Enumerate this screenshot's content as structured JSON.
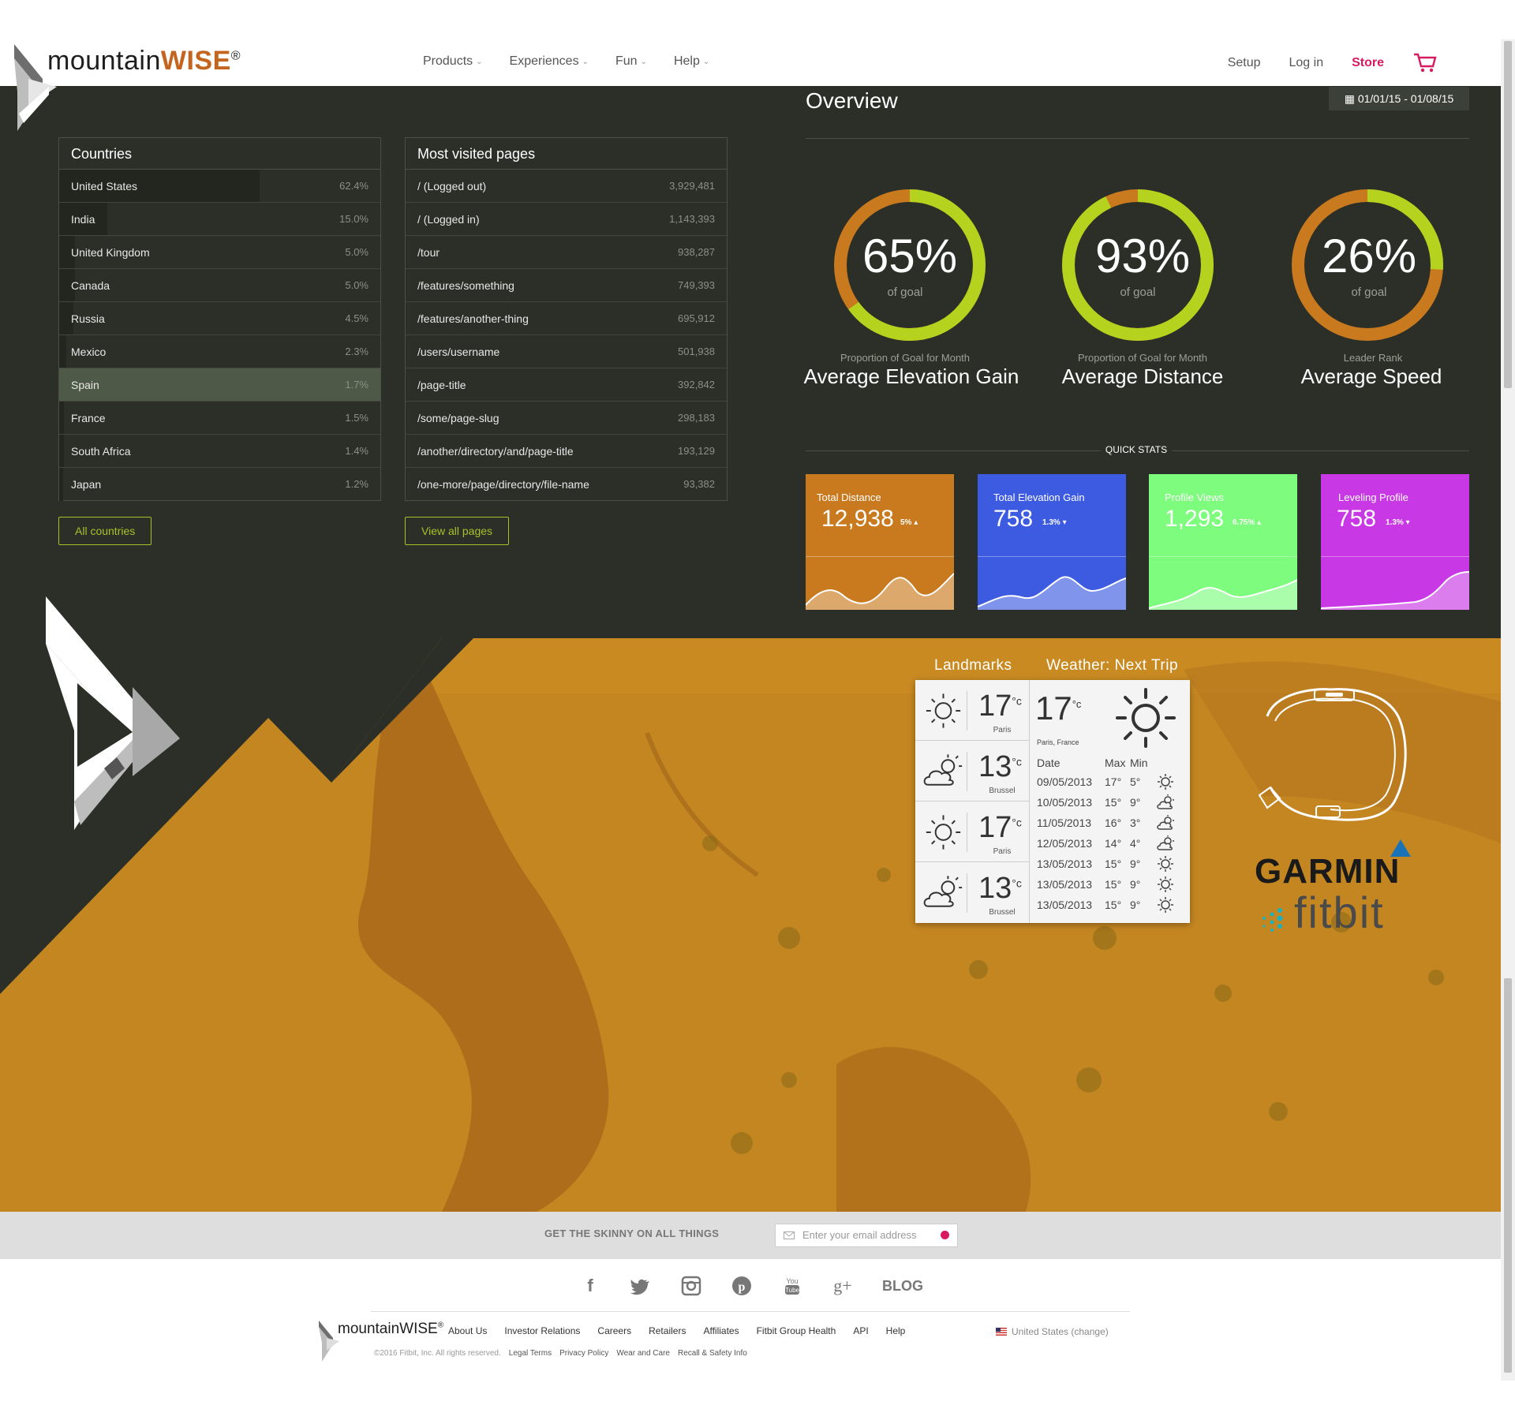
{
  "brand": {
    "name_main": "mountain",
    "name_accent": "WISE",
    "mark": "®"
  },
  "nav": {
    "items": [
      {
        "label": "Products"
      },
      {
        "label": "Experiences"
      },
      {
        "label": "Fun"
      },
      {
        "label": "Help"
      }
    ],
    "setup": "Setup",
    "login": "Log in",
    "store": "Store"
  },
  "countries": {
    "title": "Countries",
    "rows": [
      {
        "name": "United States",
        "value": "62.4%",
        "pct": 62.4
      },
      {
        "name": "India",
        "value": "15.0%",
        "pct": 15.0
      },
      {
        "name": "United Kingdom",
        "value": "5.0%",
        "pct": 5.0
      },
      {
        "name": "Canada",
        "value": "5.0%",
        "pct": 5.0
      },
      {
        "name": "Russia",
        "value": "4.5%",
        "pct": 4.5
      },
      {
        "name": "Mexico",
        "value": "2.3%",
        "pct": 2.3
      },
      {
        "name": "Spain",
        "value": "1.7%",
        "pct": 1.7,
        "active": true
      },
      {
        "name": "France",
        "value": "1.5%",
        "pct": 1.5
      },
      {
        "name": "South Africa",
        "value": "1.4%",
        "pct": 1.4
      },
      {
        "name": "Japan",
        "value": "1.2%",
        "pct": 1.2
      }
    ],
    "button": "All countries"
  },
  "pages": {
    "title": "Most visited pages",
    "rows": [
      {
        "name": "/ (Logged out)",
        "value": "3,929,481"
      },
      {
        "name": "/ (Logged in)",
        "value": "1,143,393"
      },
      {
        "name": "/tour",
        "value": "938,287"
      },
      {
        "name": "/features/something",
        "value": "749,393"
      },
      {
        "name": "/features/another-thing",
        "value": "695,912"
      },
      {
        "name": "/users/username",
        "value": "501,938"
      },
      {
        "name": "/page-title",
        "value": "392,842"
      },
      {
        "name": "/some/page-slug",
        "value": "298,183"
      },
      {
        "name": "/another/directory/and/page-title",
        "value": "193,129"
      },
      {
        "name": "/one-more/page/directory/file-name",
        "value": "93,382"
      }
    ],
    "button": "View all pages"
  },
  "overview": {
    "title": "Overview",
    "date_range": "01/01/15 - 01/08/15",
    "gauges": [
      {
        "value": "65%",
        "sub": "of goal",
        "caption": "Proportion of Goal for Month",
        "name": "Average Elevation Gain",
        "fraction": 0.65
      },
      {
        "value": "93%",
        "sub": "of goal",
        "caption": "Proportion of Goal for Month",
        "name": "Average Distance",
        "fraction": 0.93
      },
      {
        "value": "26%",
        "sub": "of goal",
        "caption": "Leader Rank",
        "name": "Average Speed",
        "fraction": 0.26
      }
    ],
    "quick_stats_label": "QUICK STATS",
    "stats": [
      {
        "title": "Total Distance",
        "value": "12,938",
        "change": "5%",
        "color": "#c97a1e"
      },
      {
        "title": "Total Elevation Gain",
        "value": "758",
        "change": "1.3%",
        "color": "#3d5be0"
      },
      {
        "title": "Profile Views",
        "value": "1,293",
        "change": "6.75%",
        "color": "#7dfc7d"
      },
      {
        "title": "Leveling Profile",
        "value": "758",
        "change": "1.3%",
        "color": "#c838e4"
      }
    ]
  },
  "weather": {
    "landmarks_title": "Landmarks",
    "trip_title": "Weather: Next Trip",
    "cities": [
      {
        "temp": "17",
        "unit": "°c",
        "city": "Paris",
        "icon": "sun-icon"
      },
      {
        "temp": "13",
        "unit": "°c",
        "city": "Brussel",
        "icon": "cloud-sun-icon"
      },
      {
        "temp": "17",
        "unit": "°c",
        "city": "Paris",
        "icon": "sun-icon"
      },
      {
        "temp": "13",
        "unit": "°c",
        "city": "Brussel",
        "icon": "cloud-sun-icon"
      }
    ],
    "current": {
      "temp": "17",
      "unit": "°c",
      "location": "Paris, France"
    },
    "table_headers": {
      "date": "Date",
      "max": "Max",
      "min": "Min"
    },
    "forecast": [
      {
        "date": "09/05/2013",
        "max": "17°",
        "min": "5°",
        "icon": "sun-icon"
      },
      {
        "date": "10/05/2013",
        "max": "15°",
        "min": "9°",
        "icon": "cloud-sun-icon"
      },
      {
        "date": "11/05/2013",
        "max": "16°",
        "min": "3°",
        "icon": "cloud-sun-icon"
      },
      {
        "date": "12/05/2013",
        "max": "14°",
        "min": "4°",
        "icon": "cloud-sun-icon"
      },
      {
        "date": "13/05/2013",
        "max": "15°",
        "min": "9°",
        "icon": "sun-icon"
      },
      {
        "date": "13/05/2013",
        "max": "15°",
        "min": "9°",
        "icon": "sun-icon"
      },
      {
        "date": "13/05/2013",
        "max": "15°",
        "min": "9°",
        "icon": "sun-icon"
      }
    ]
  },
  "partners": {
    "garmin": "GARMIN",
    "fitbit": "fitbit"
  },
  "newsletter": {
    "label": "GET THE SKINNY ON ALL THINGS",
    "placeholder": "Enter your email address"
  },
  "footer": {
    "blog": "BLOG",
    "brand": "mountainWISE",
    "mark": "®",
    "links": [
      "About Us",
      "Investor Relations",
      "Careers",
      "Retailers",
      "Affiliates",
      "Fitbit Group Health",
      "API",
      "Help"
    ],
    "country": "United States (change)",
    "copyright": "©2016 Fitbit, Inc. All rights reserved.",
    "legal": [
      "Legal Terms",
      "Privacy Policy",
      "Wear and Care",
      "Recall & Safety Info"
    ],
    "socials": [
      "facebook-icon",
      "twitter-icon",
      "instagram-icon",
      "pinterest-icon",
      "youtube-icon",
      "google-plus-icon"
    ]
  },
  "colors": {
    "dark_bg": "#2b2f28",
    "accent_green": "#a4c22a",
    "accent_orange": "#c97a1e",
    "store_pink": "#d81b60",
    "hero": "#c98a22"
  }
}
